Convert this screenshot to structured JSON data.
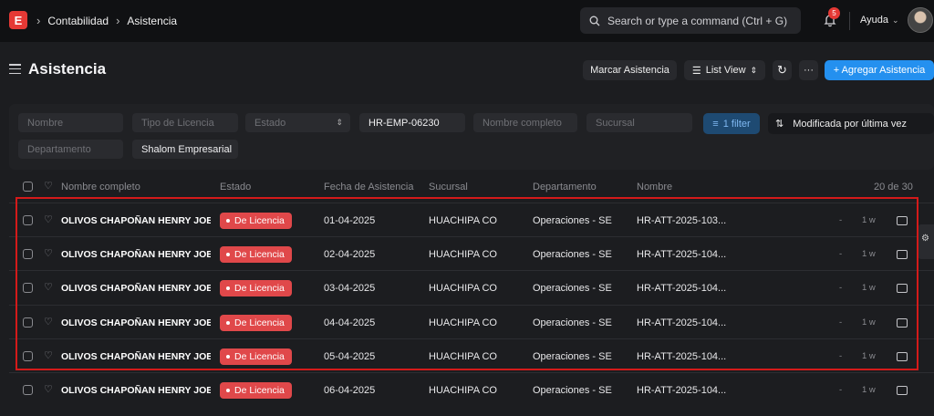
{
  "navbar": {
    "logo": "E",
    "breadcrumbs": [
      "Contabilidad",
      "Asistencia"
    ],
    "search_placeholder": "Search or type a command (Ctrl + G)",
    "notifications_count": "5",
    "help_label": "Ayuda"
  },
  "header": {
    "title": "Asistencia",
    "mark_attendance_label": "Marcar Asistencia",
    "view_label": "List View",
    "more_label": "···",
    "add_label": "+ Agregar Asistencia"
  },
  "filters": {
    "nombre_placeholder": "Nombre",
    "tipo_licencia_placeholder": "Tipo de Licencia",
    "estado_placeholder": "Estado",
    "employee_value": "HR-EMP-06230",
    "nombre_completo_placeholder": "Nombre completo",
    "sucursal_placeholder": "Sucursal",
    "departamento_placeholder": "Departamento",
    "company_value": "Shalom Empresarial",
    "filter_button": "1 filter",
    "sort_label": "Modificada por última vez"
  },
  "table": {
    "columns": [
      "Nombre completo",
      "Estado",
      "Fecha de Asistencia",
      "Sucursal",
      "Departamento",
      "Nombre"
    ],
    "count": "20 de 30",
    "rows": [
      {
        "name": "OLIVOS CHAPOÑAN HENRY JOE",
        "status": "De Licencia",
        "date": "01-04-2025",
        "branch": "HUACHIPA CO",
        "dept": "Operaciones - SE",
        "id": "HR-ATT-2025-103...",
        "dash": "-",
        "time": "1 w"
      },
      {
        "name": "OLIVOS CHAPOÑAN HENRY JOE",
        "status": "De Licencia",
        "date": "02-04-2025",
        "branch": "HUACHIPA CO",
        "dept": "Operaciones - SE",
        "id": "HR-ATT-2025-104...",
        "dash": "-",
        "time": "1 w"
      },
      {
        "name": "OLIVOS CHAPOÑAN HENRY JOE",
        "status": "De Licencia",
        "date": "03-04-2025",
        "branch": "HUACHIPA CO",
        "dept": "Operaciones - SE",
        "id": "HR-ATT-2025-104...",
        "dash": "-",
        "time": "1 w"
      },
      {
        "name": "OLIVOS CHAPOÑAN HENRY JOE",
        "status": "De Licencia",
        "date": "04-04-2025",
        "branch": "HUACHIPA CO",
        "dept": "Operaciones - SE",
        "id": "HR-ATT-2025-104...",
        "dash": "-",
        "time": "1 w"
      },
      {
        "name": "OLIVOS CHAPOÑAN HENRY JOE",
        "status": "De Licencia",
        "date": "05-04-2025",
        "branch": "HUACHIPA CO",
        "dept": "Operaciones - SE",
        "id": "HR-ATT-2025-104...",
        "dash": "-",
        "time": "1 w"
      },
      {
        "name": "OLIVOS CHAPOÑAN HENRY JOE",
        "status": "De Licencia",
        "date": "06-04-2025",
        "branch": "HUACHIPA CO",
        "dept": "Operaciones - SE",
        "id": "HR-ATT-2025-104...",
        "dash": "-",
        "time": "1 w"
      }
    ]
  },
  "colors": {
    "accent": "#2490ef",
    "status_red": "#e0484a",
    "highlight": "#d41a1a"
  }
}
